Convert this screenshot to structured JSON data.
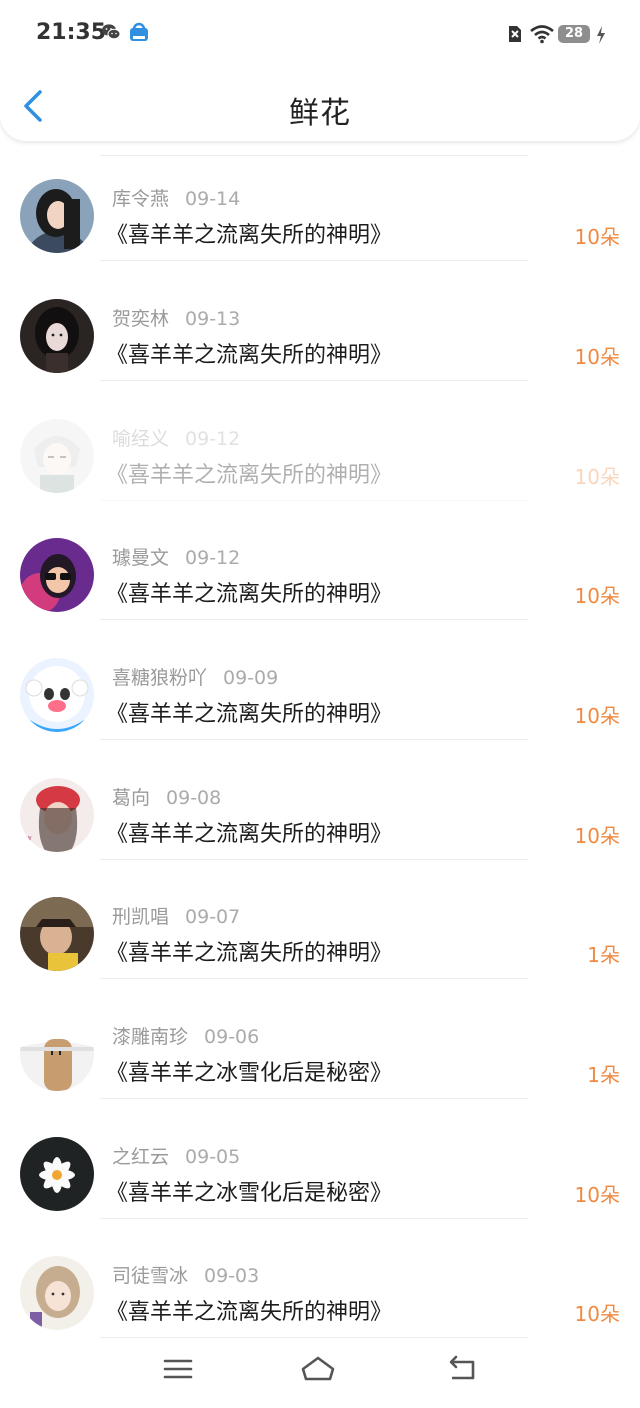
{
  "status": {
    "time": "21:35",
    "battery": "28"
  },
  "header": {
    "title": "鲜花"
  },
  "records": [
    {
      "name": "库令燕",
      "date": "09-14",
      "book": "《喜羊羊之流离失所的神明》",
      "count": "10朵",
      "avatar": "girl-long-hair"
    },
    {
      "name": "贺奕林",
      "date": "09-13",
      "book": "《喜羊羊之流离失所的神明》",
      "count": "10朵",
      "avatar": "girl-dark"
    },
    {
      "name": "喻经义",
      "date": "09-12",
      "book": "《喜羊羊之流离失所的神明》",
      "count": "10朵",
      "avatar": "anime-boy"
    },
    {
      "name": "璩曼文",
      "date": "09-12",
      "book": "《喜羊羊之流离失所的神明》",
      "count": "10朵",
      "avatar": "girl-sunglasses"
    },
    {
      "name": "喜糖狼粉吖",
      "date": "09-09",
      "book": "《喜羊羊之流离失所的神明》",
      "count": "10朵",
      "avatar": "sheep-cartoon"
    },
    {
      "name": "葛向",
      "date": "09-08",
      "book": "《喜羊羊之流离失所的神明》",
      "count": "10朵",
      "avatar": "girl-red-hat"
    },
    {
      "name": "刑凯唱",
      "date": "09-07",
      "book": "《喜羊羊之流离失所的神明》",
      "count": "1朵",
      "avatar": "girl-hat"
    },
    {
      "name": "漆雕南珍",
      "date": "09-06",
      "book": "《喜羊羊之冰雪化后是秘密》",
      "count": "1朵",
      "avatar": "finger-face"
    },
    {
      "name": "之红云",
      "date": "09-05",
      "book": "《喜羊羊之冰雪化后是秘密》",
      "count": "10朵",
      "avatar": "white-flower"
    },
    {
      "name": "司徒雪冰",
      "date": "09-03",
      "book": "《喜羊羊之流离失所的神明》",
      "count": "10朵",
      "avatar": "girl-light"
    }
  ],
  "colors": {
    "accent": "#2f8fe0",
    "count": "#f08a43",
    "text": "#1d1d1d",
    "meta": "#9a9a9a"
  }
}
